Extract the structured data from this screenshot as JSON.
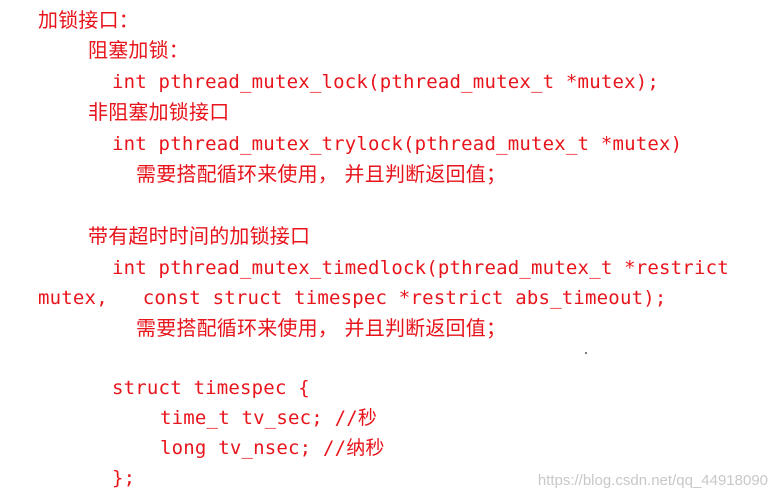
{
  "doc": {
    "lines": [
      "加锁接口：",
      "阻塞加锁：",
      "int pthread_mutex_lock(pthread_mutex_t *mutex);",
      "非阻塞加锁接口",
      "int pthread_mutex_trylock(pthread_mutex_t *mutex)",
      "需要搭配循环来使用， 并且判断返回值；",
      "带有超时时间的加锁接口",
      "int pthread_mutex_timedlock(pthread_mutex_t *restrict",
      "mutex,   const struct timespec *restrict abs_timeout);",
      "需要搭配循环来使用， 并且判断返回值；",
      "struct timespec {",
      "time_t tv_sec; //秒",
      "long tv_nsec; //纳秒",
      "};"
    ]
  },
  "watermark": {
    "text": "https://blog.csdn.net/qq_44918090"
  }
}
